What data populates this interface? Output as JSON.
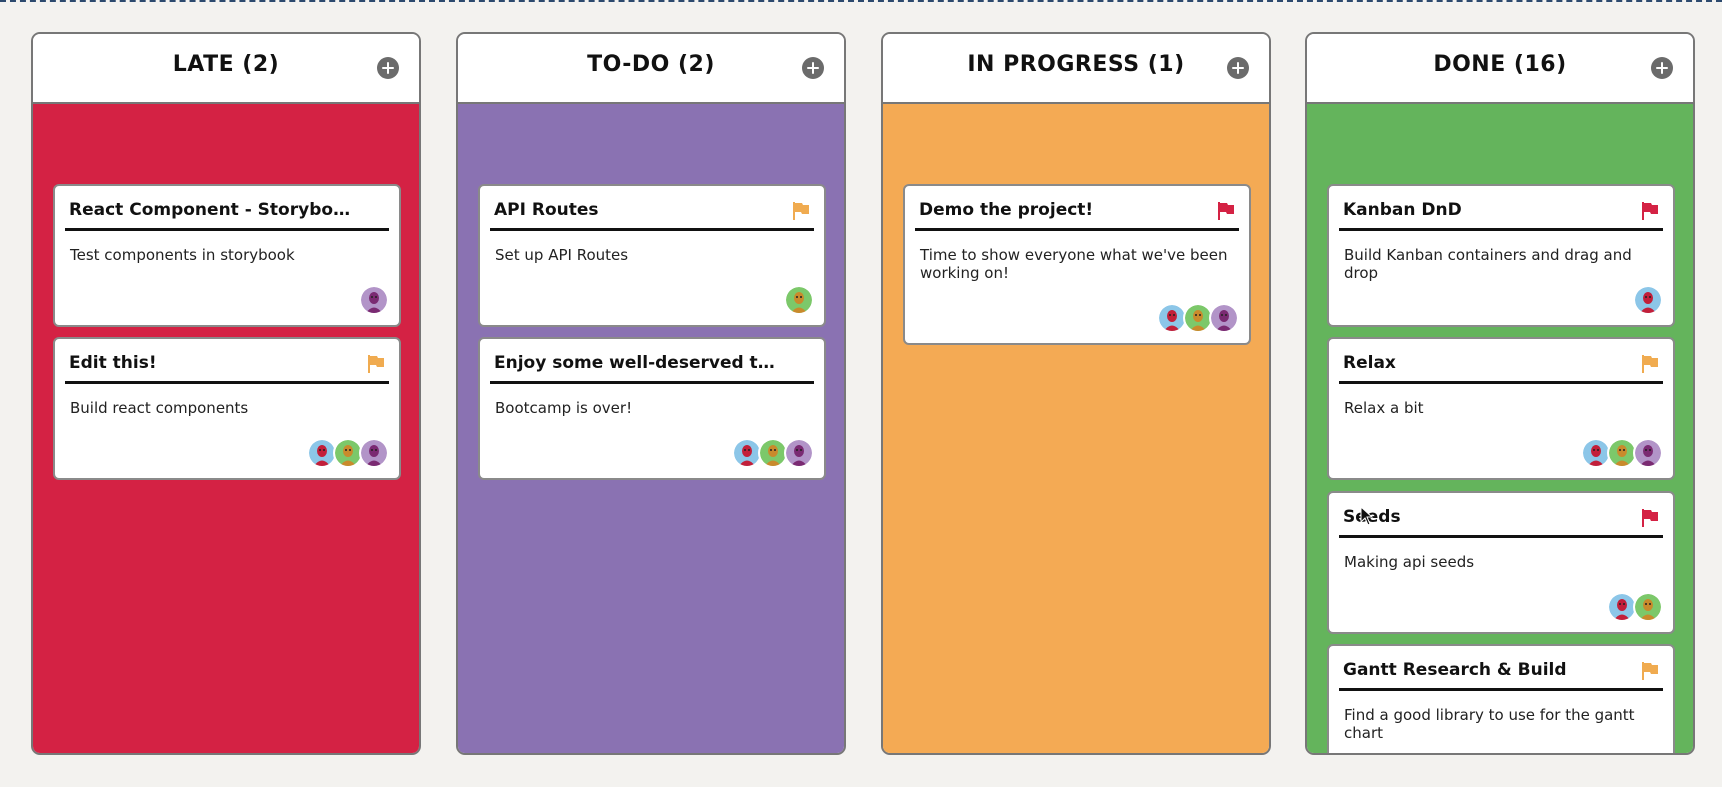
{
  "board": {
    "columns": [
      {
        "title": "LATE (2)",
        "color": "#d42244",
        "cards": [
          {
            "title": "React Component - Storyboo...",
            "description": "Test components in storybook",
            "flag": null,
            "avatars": [
              "purple"
            ]
          },
          {
            "title": "Edit this!",
            "description": "Build react components",
            "flag": "#f0ab50",
            "avatars": [
              "blue",
              "green",
              "purple"
            ]
          }
        ]
      },
      {
        "title": "TO-DO (2)",
        "color": "#8a72b2",
        "cards": [
          {
            "title": "API Routes",
            "description": "Set up API Routes",
            "flag": "#f0ab50",
            "avatars": [
              "green"
            ]
          },
          {
            "title": "Enjoy some well-deserved ti...",
            "description": "Bootcamp is over!",
            "flag": null,
            "avatars": [
              "blue",
              "green",
              "purple"
            ]
          }
        ]
      },
      {
        "title": "IN PROGRESS (1)",
        "color": "#f4aa54",
        "cards": [
          {
            "title": "Demo the project!",
            "description": "Time to show everyone what we've been working on!",
            "flag": "#d42244",
            "avatars": [
              "blue",
              "green",
              "purple"
            ]
          }
        ]
      },
      {
        "title": "DONE (16)",
        "color": "#64b45c",
        "cards": [
          {
            "title": "Kanban DnD",
            "description": "Build Kanban containers and drag and drop",
            "flag": "#d42244",
            "avatars": [
              "blue"
            ]
          },
          {
            "title": "Relax",
            "description": "Relax a bit",
            "flag": "#f0ab50",
            "avatars": [
              "blue",
              "green",
              "purple"
            ]
          },
          {
            "title": "Seeds",
            "description": "Making api seeds",
            "flag": "#d42244",
            "avatars": [
              "blue",
              "green"
            ]
          },
          {
            "title": "Gantt Research & Build",
            "description": "Find a good library to use for the gantt chart",
            "flag": "#f0ab50",
            "avatars": [
              "blue",
              "green"
            ]
          }
        ]
      }
    ]
  },
  "icons": {
    "add": "plus-circle-icon",
    "flag": "flag-icon",
    "avatar": "user-avatar"
  },
  "avatar_colors": {
    "blue": "#8cc6e8",
    "green": "#7cc86a",
    "purple": "#b294c8"
  }
}
